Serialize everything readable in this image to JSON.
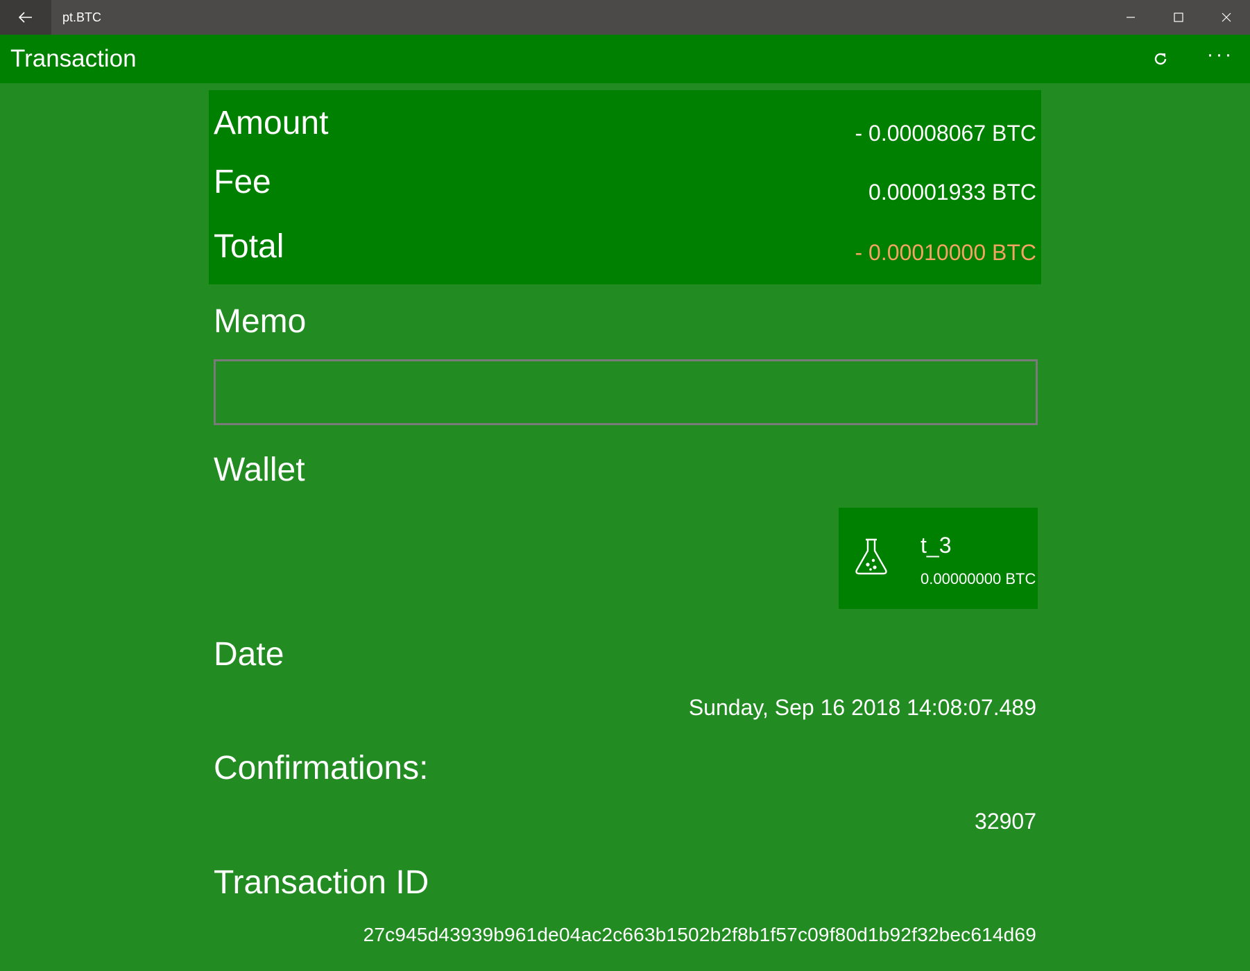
{
  "window": {
    "app_title": "pt.BTC"
  },
  "appbar": {
    "title": "Transaction"
  },
  "summary": {
    "amount_label": "Amount",
    "amount_value": "- 0.00008067 BTC",
    "fee_label": "Fee",
    "fee_value": "0.00001933 BTC",
    "total_label": "Total",
    "total_value": "- 0.00010000 BTC",
    "total_color": "#f4a460"
  },
  "memo": {
    "label": "Memo",
    "value": ""
  },
  "wallet": {
    "label": "Wallet",
    "name": "t_3",
    "balance": "0.00000000 BTC",
    "icon": "flask-icon"
  },
  "date": {
    "label": "Date",
    "value": "Sunday, Sep 16 2018 14:08:07.489"
  },
  "confirmations": {
    "label": "Confirmations:",
    "value": "32907"
  },
  "transaction_id": {
    "label": "Transaction ID",
    "value": "27c945d43939b961de04ac2c663b1502b2f8b1f57c09f80d1b92f32bec614d69"
  },
  "colors": {
    "background": "#228b22",
    "header": "#008000",
    "titlebar": "#4c4a48"
  }
}
